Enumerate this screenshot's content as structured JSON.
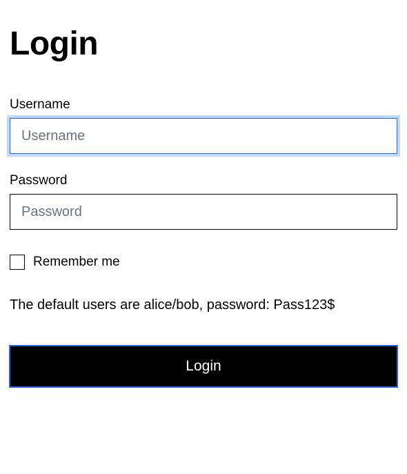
{
  "title": "Login",
  "username": {
    "label": "Username",
    "placeholder": "Username",
    "value": ""
  },
  "password": {
    "label": "Password",
    "placeholder": "Password",
    "value": ""
  },
  "remember": {
    "label": "Remember me",
    "checked": false
  },
  "hint": "The default users are alice/bob, password: Pass123$",
  "submit_label": "Login"
}
